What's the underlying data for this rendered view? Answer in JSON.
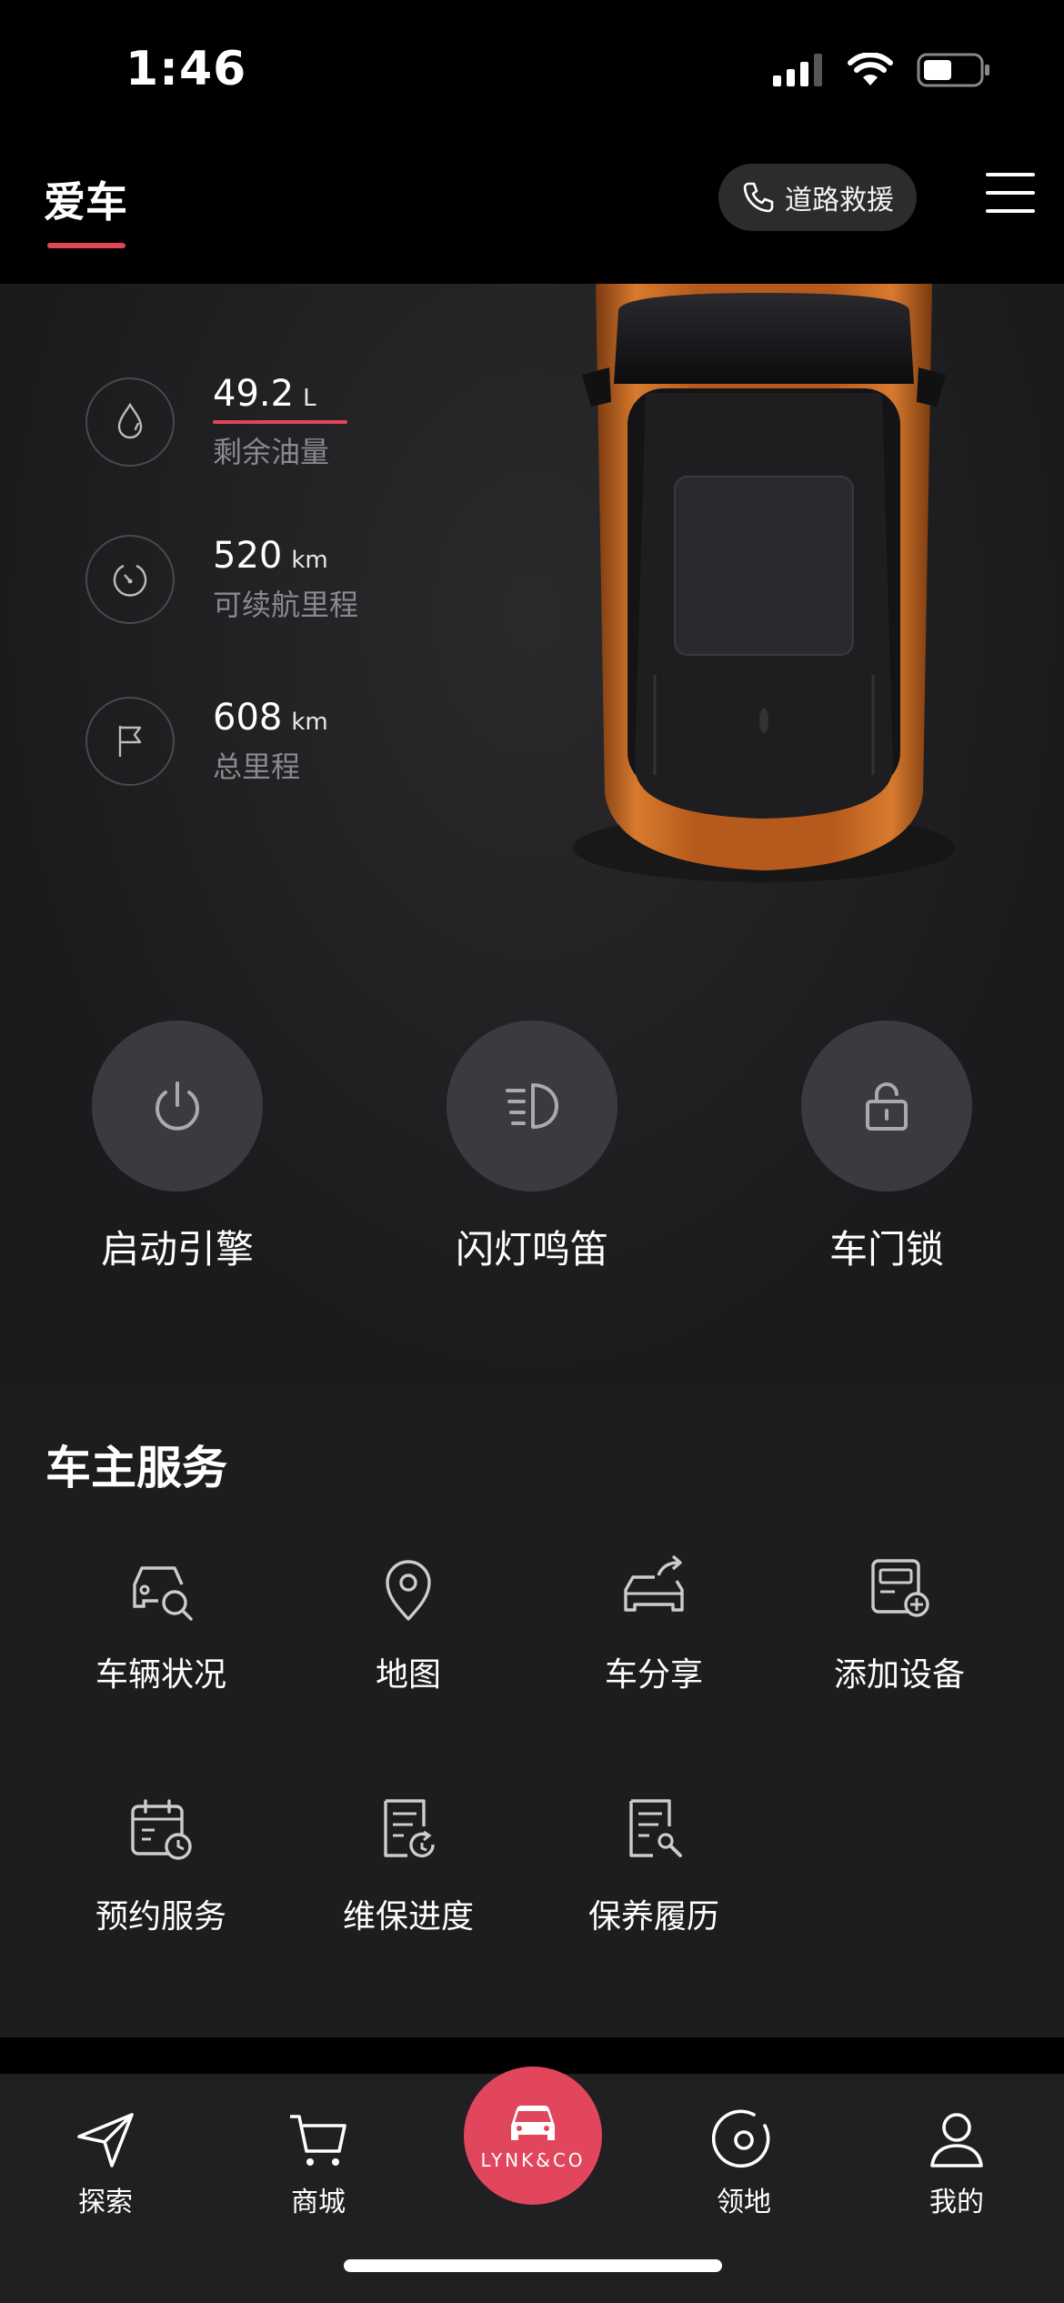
{
  "status_bar": {
    "time": "1:46"
  },
  "header": {
    "title": "爱车",
    "rescue_label": "道路救援"
  },
  "vehicle": {
    "stats": [
      {
        "value": "49.2",
        "unit": "L",
        "label": "剩余油量"
      },
      {
        "value": "520",
        "unit": "km",
        "label": "可续航里程"
      },
      {
        "value": "608",
        "unit": "km",
        "label": "总里程"
      }
    ],
    "controls": [
      {
        "label": "启动引擎",
        "icon": "power-icon"
      },
      {
        "label": "闪灯鸣笛",
        "icon": "headlight-icon"
      },
      {
        "label": "车门锁",
        "icon": "unlock-icon"
      }
    ]
  },
  "services": {
    "title": "车主服务",
    "items": [
      {
        "label": "车辆状况",
        "icon": "car-search-icon"
      },
      {
        "label": "地图",
        "icon": "map-pin-icon"
      },
      {
        "label": "车分享",
        "icon": "car-share-icon"
      },
      {
        "label": "添加设备",
        "icon": "add-device-icon"
      },
      {
        "label": "预约服务",
        "icon": "calendar-clock-icon"
      },
      {
        "label": "维保进度",
        "icon": "progress-doc-icon"
      },
      {
        "label": "保养履历",
        "icon": "maintenance-doc-icon"
      }
    ]
  },
  "tabbar": {
    "items": [
      {
        "label": "探索",
        "icon": "send-icon"
      },
      {
        "label": "商城",
        "icon": "cart-icon"
      },
      {
        "label": "LYNK&CO",
        "icon": "car-icon"
      },
      {
        "label": "领地",
        "icon": "target-icon"
      },
      {
        "label": "我的",
        "icon": "user-icon"
      }
    ]
  },
  "colors": {
    "accent": "#e2465c",
    "background": "#1b1b1d",
    "control_circle": "#3a3a3f"
  }
}
